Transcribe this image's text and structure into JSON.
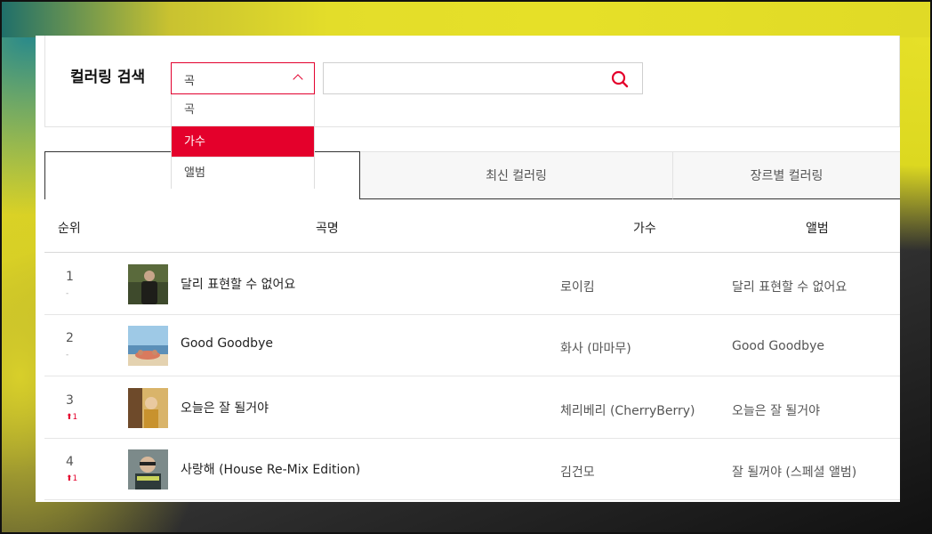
{
  "search": {
    "title": "컬러링 검색",
    "select_value": "곡",
    "input_value": "",
    "options": [
      "곡",
      "가수",
      "앨범"
    ],
    "highlighted_option": "가수"
  },
  "tabs": [
    {
      "label": ""
    },
    {
      "label": "최신 컬러링"
    },
    {
      "label": "장르별 컬러링"
    }
  ],
  "table": {
    "headers": {
      "rank": "순위",
      "song": "곡명",
      "artist": "가수",
      "album": "앨범"
    },
    "rows": [
      {
        "rank": "1",
        "change": "-",
        "title": "달리 표현할 수 없어요",
        "artist": "로이킴",
        "album": "달리 표현할 수 없어요"
      },
      {
        "rank": "2",
        "change": "-",
        "title": "Good Goodbye",
        "artist": "화사 (마마무)",
        "album": "Good Goodbye"
      },
      {
        "rank": "3",
        "change": "1",
        "title": "오늘은 잘 될거야",
        "artist": "체리베리 (CherryBerry)",
        "album": "오늘은 잘 될거야"
      },
      {
        "rank": "4",
        "change": "1",
        "title": "사랑해 (House Re-Mix Edition)",
        "artist": "김건모",
        "album": "잘 될꺼야 (스페셜 앨범)"
      }
    ]
  },
  "colors": {
    "accent": "#e4002b"
  }
}
